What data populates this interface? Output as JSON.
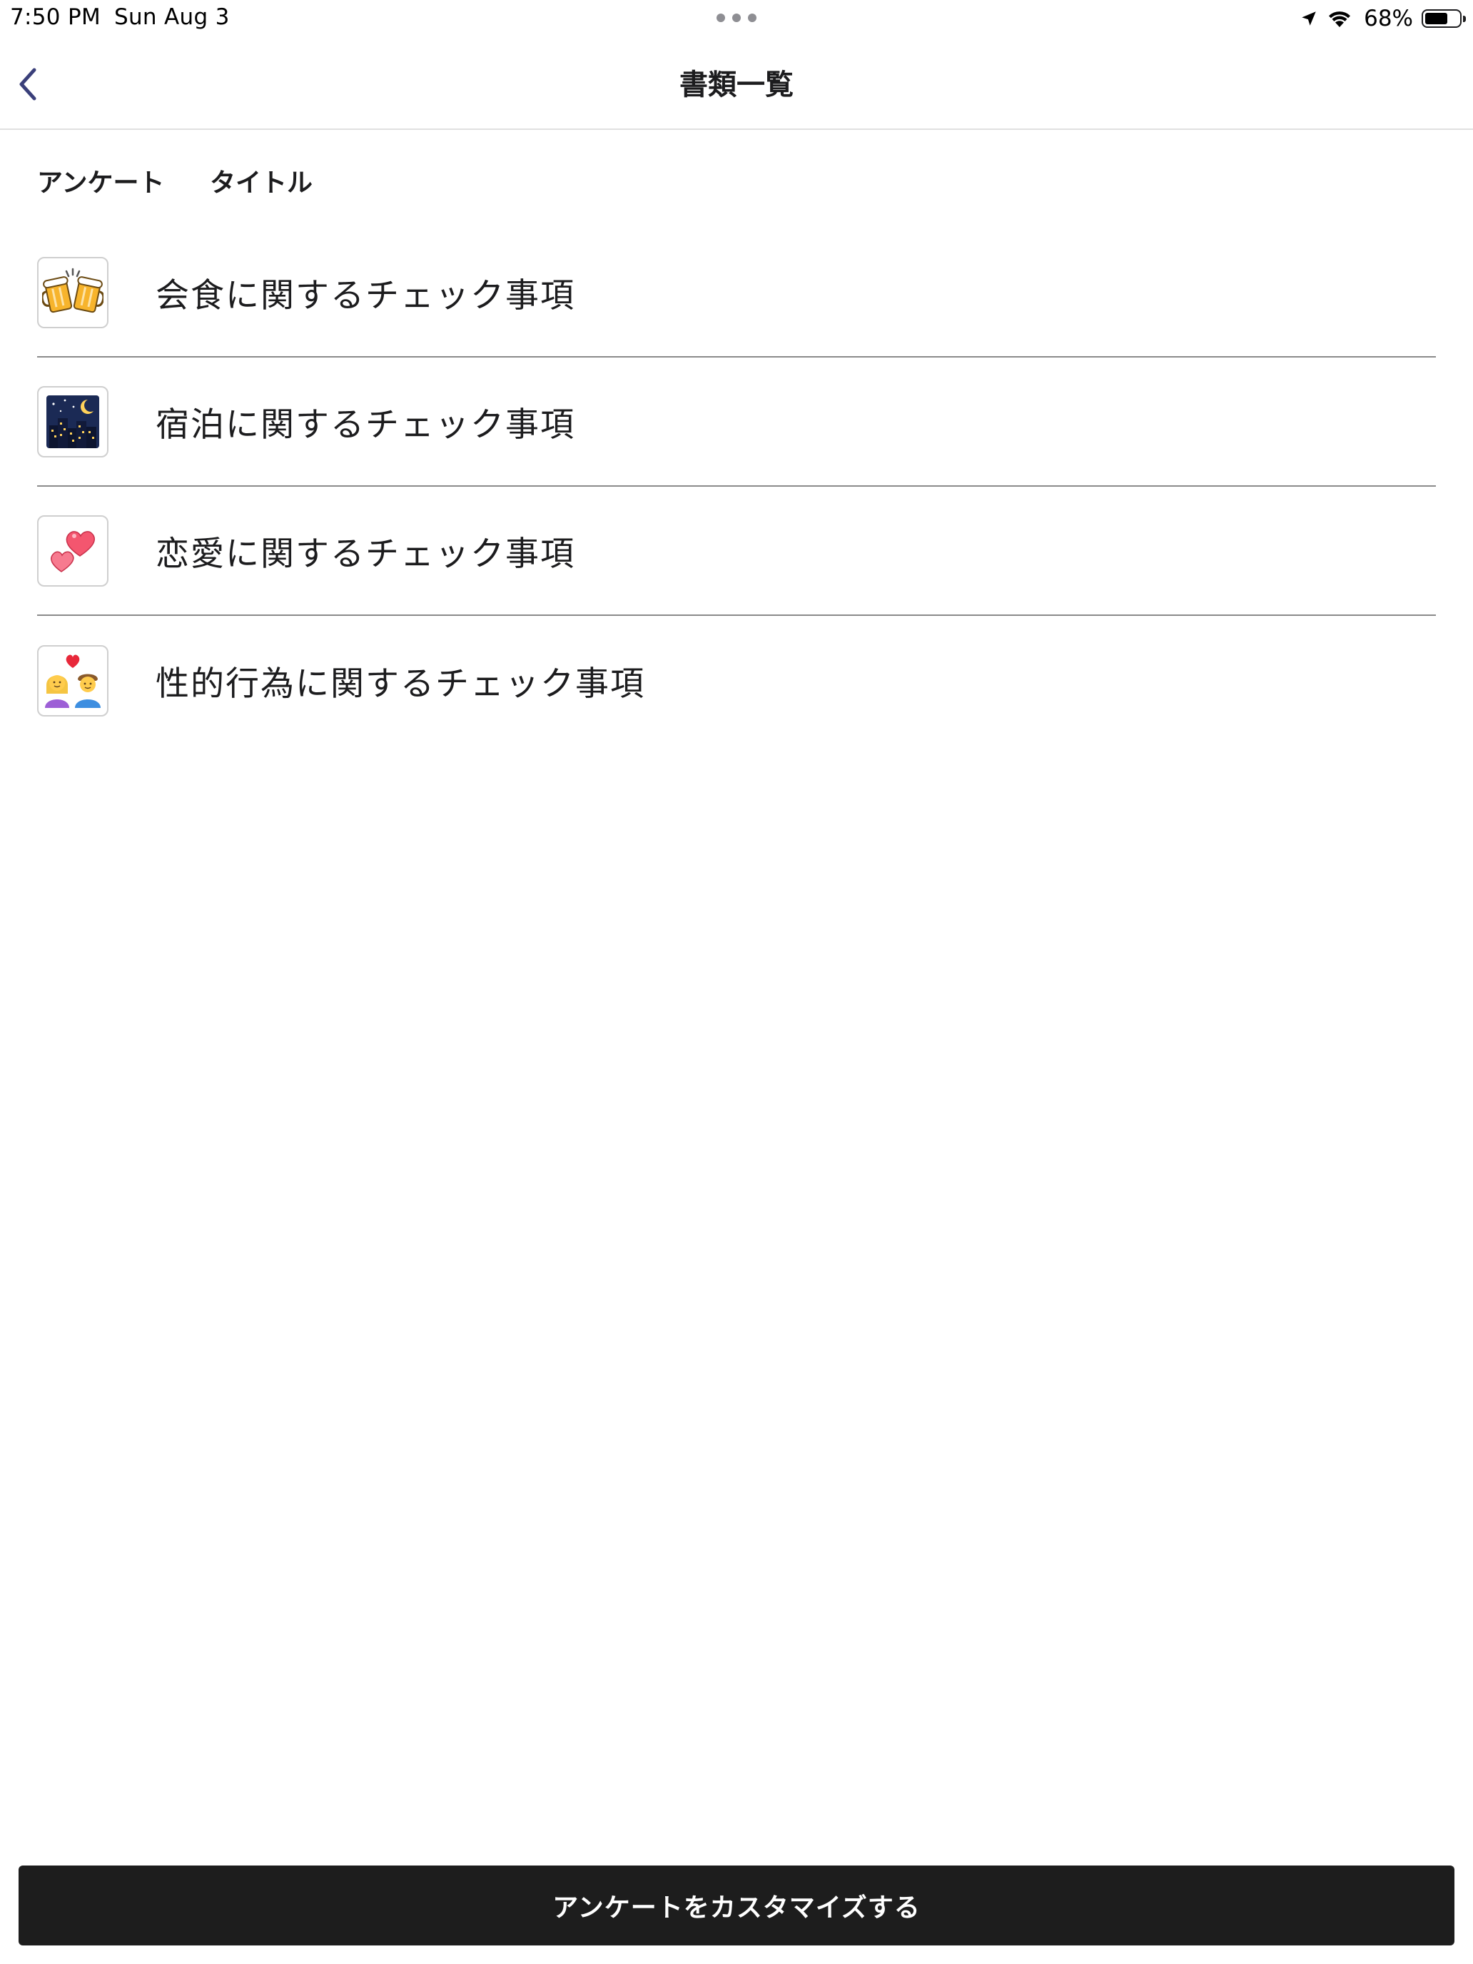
{
  "status_bar": {
    "time": "7:50 PM",
    "date": "Sun Aug 3",
    "battery_percent": "68%",
    "battery_level": 0.68,
    "icons": [
      "location-arrow-icon",
      "wifi-icon",
      "battery-icon"
    ]
  },
  "nav": {
    "title": "書類一覧",
    "back_icon": "chevron-left-icon",
    "accent_color": "#3a3f7a"
  },
  "columns": {
    "survey": "アンケート",
    "title": "タイトル"
  },
  "documents": [
    {
      "icon": "beer-mugs-icon",
      "title": "会食に関するチェック事項"
    },
    {
      "icon": "night-city-icon",
      "title": "宿泊に関するチェック事項"
    },
    {
      "icon": "two-hearts-icon",
      "title": "恋愛に関するチェック事項"
    },
    {
      "icon": "couple-with-heart-icon",
      "title": "性的行為に関するチェック事項"
    }
  ],
  "customize_button": {
    "label": "アンケートをカスタマイズする"
  }
}
